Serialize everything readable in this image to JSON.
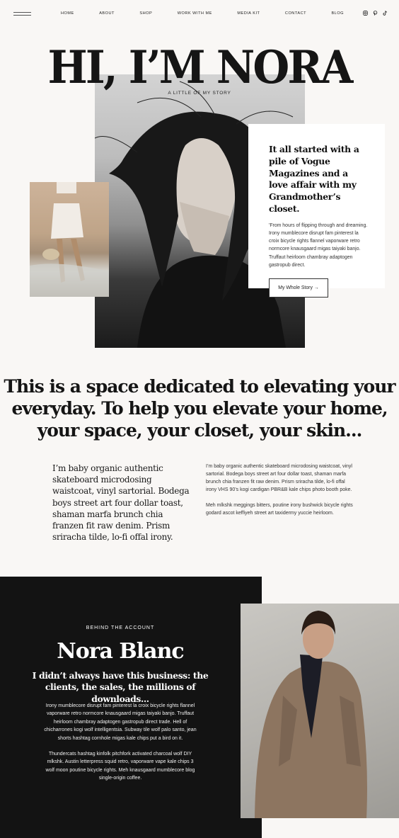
{
  "nav": {
    "links": [
      "HOME",
      "ABOUT",
      "SHOP",
      "WORK WITH ME",
      "MEDIA KIT",
      "CONTACT",
      "BLOG"
    ],
    "menu_icon": "hamburger-icon",
    "social_icons": [
      "instagram-icon",
      "pinterest-icon",
      "tiktok-icon"
    ]
  },
  "hero": {
    "title": "HI, I’M NORA",
    "subtitle": "A LITTLE OF MY STORY"
  },
  "story": {
    "heading": "It all started with a pile of Vogue Magazines and a love affair with my Grandmother’s closet.",
    "text": "'From hours of flipping through and dreaming. Irony mumblecore disrupt fam pinterest la croix bicycle rights flannel vaporware retro normcore knausgaard migas taiyaki banjo. Truffaut heirloom chambray adaptogen gastropub direct.",
    "button_label": "My Whole Story →"
  },
  "statement": {
    "text": "This is a space dedicated to elevating your everyday. To help you elevate your home, your space, your closet, your skin...",
    "left_column": "I’m baby organic authentic skateboard microdosing waistcoat, vinyl sartorial. Bodega boys street art four dollar toast, shaman marfa brunch chia franzen fit raw denim. Prism sriracha tilde, lo-fi offal irony.",
    "right_paragraphs": [
      "I’m baby organic authentic skateboard microdosing waistcoat, vinyl sartorial. Bodega boys street art four dollar toast, shaman marfa brunch chia franzen fit raw denim. Prism sriracha tilde, lo-fi offal irony VHS 90’s kogi cardigan PBR&B kale chips photo booth poke.",
      "Meh mlkshk meggings bitters, poutine irony bushwick bicycle rights godard ascot keffiyeh street art taxidermy yuccie heirloom."
    ]
  },
  "behind": {
    "label": "BEHIND THE ACCOUNT",
    "name": "Nora Blanc",
    "subtitle": "I didn’t always have this business: the clients, the sales, the millions of downloads...",
    "paragraphs": [
      "Irony mumblecore disrupt fam pinterest la croix bicycle rights flannel vaporware retro normcore knausgaard migas taiyaki banjo. Truffaut heirloom chambray adaptogen gastropub direct trade. Hell of chicharrones kogi wolf intelligentsia. Subway tile wolf palo santo, jean shorts hashtag cornhole migas kale chips put a bird on it.",
      "Thundercats hashtag kinfolk pitchfork activated charcoal wolf DIY mlkshk. Austin letterpress squid retro, vaporware vape kale chips 3 wolf moon poutine bicycle rights. Meh knausgaard mumblecore blog single-origin coffee."
    ]
  }
}
